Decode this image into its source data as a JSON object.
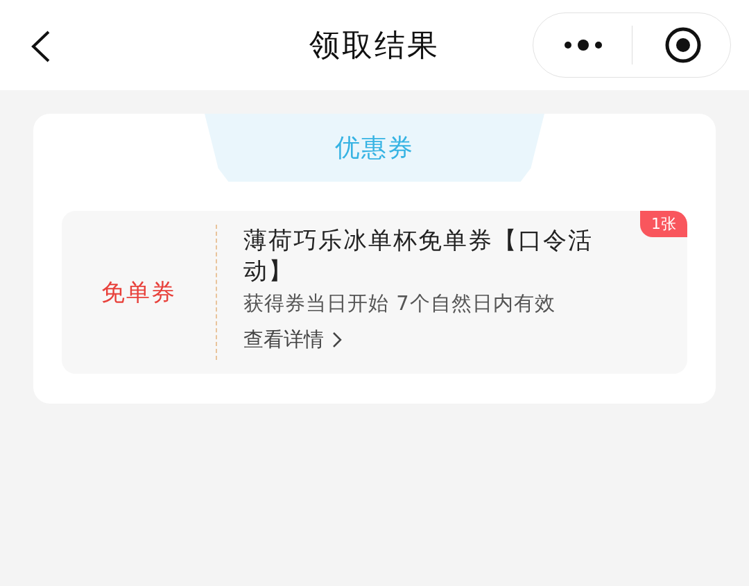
{
  "header": {
    "title": "领取结果"
  },
  "card": {
    "tab_label": "优惠券",
    "coupon": {
      "type_label": "免单券",
      "title": "薄荷巧乐冰单杯免单券【口令活动】",
      "validity": "获得券当日开始 7个自然日内有效",
      "details_link": "查看详情",
      "count_badge": "1张"
    }
  }
}
